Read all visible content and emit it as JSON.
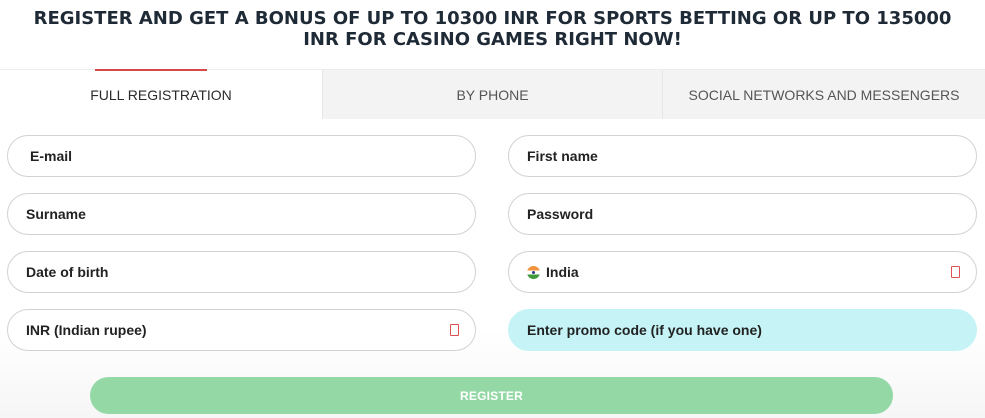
{
  "headline": "REGISTER AND GET A BONUS OF UP TO 10300 INR FOR SPORTS BETTING OR UP TO 135000 INR FOR CASINO GAMES RIGHT NOW!",
  "tabs": [
    {
      "label": "FULL REGISTRATION",
      "active": true
    },
    {
      "label": "BY PHONE",
      "active": false
    },
    {
      "label": "SOCIAL NETWORKS AND MESSENGERS",
      "active": false
    }
  ],
  "form": {
    "email": "E-mail",
    "first_name": "First name",
    "surname": "Surname",
    "password": "Password",
    "date_of_birth": "Date of birth",
    "country": {
      "value": "India",
      "flag_icon": "india-flag-icon"
    },
    "currency": "INR (Indian rupee)",
    "promo_code": "Enter promo code (if you have one)"
  },
  "register_button": "REGISTER",
  "colors": {
    "tab_accent": "#d84a4a",
    "promo_bg": "#c6f4f6",
    "register_bg": "#94d8a6",
    "dropdown_icon": "#e05252"
  }
}
